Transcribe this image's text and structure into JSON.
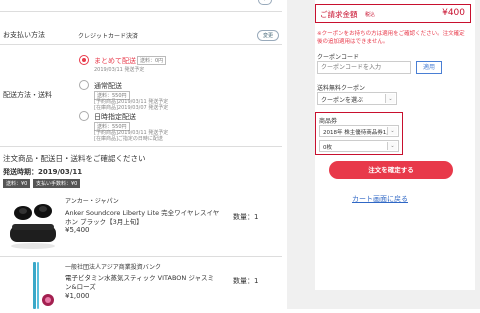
{
  "payment": {
    "label": "お支払い方法",
    "method": "クレジットカード決済",
    "change_label": "変更"
  },
  "shipping": {
    "label": "配送方法・送料",
    "options": [
      {
        "name": "まとめて配送",
        "fee": "送料：0円",
        "note1": "2019/03/11 発送予定",
        "note2": "",
        "selected": true
      },
      {
        "name": "通常配送",
        "fee": "送料：550円",
        "note1": "[予約商品]2019/03/11 発送予定",
        "note2": "[在庫商品]2019/03/07 発送予定",
        "selected": false
      },
      {
        "name": "日時指定配送",
        "fee": "送料：550円",
        "note1": "[予約商品]2019/03/11 発送予定",
        "note2": "[在庫商品]ご指定の日時に配送",
        "selected": false
      }
    ]
  },
  "confirm": {
    "heading": "注文商品・配送日・送料をご確認ください",
    "ship_date": "発送時期：2019/03/11",
    "badge_fee": "送料：¥0",
    "badge_handling": "支払い手数料：¥0"
  },
  "items": [
    {
      "brand": "アンカー・ジャパン",
      "name1": "Anker Soundcore Liberty Lite 完全ワイヤレスイヤ",
      "name2": "ホン ブラック【3月上旬】",
      "price": "¥5,400",
      "qty": "数量：1"
    },
    {
      "brand": "一般社団法人アジア商業投資バンク",
      "name1": "電子ビタミン水蒸気スティック VITABON ジャスミ",
      "name2": "ン&ローズ",
      "price": "¥1,000",
      "qty": "数量：1"
    }
  ],
  "summary": {
    "total_label": "ご請求金額",
    "tax_label": "税込",
    "total_value": "¥400",
    "warning": "※クーポンをお持ちの方は適用をご確認ください。注文確定後の追加適用はできません。",
    "coupon_label": "クーポンコード",
    "coupon_placeholder": "クーポンコードを入力",
    "apply_label": "適用",
    "free_ship_label": "送料無料クーポン",
    "free_ship_value": "クーポンを選ぶ",
    "gift_label": "商品券",
    "gift_value": "2018年 株主優待商品券1,0",
    "qty_value": "0枚",
    "submit_label": "注文を確定する",
    "back_label": "カート画面に戻る"
  },
  "colors": {
    "accent": "#e8394a",
    "frame": "#c8102e",
    "link": "#2f67c5",
    "sidebar_bg": "#f0f0f0"
  }
}
